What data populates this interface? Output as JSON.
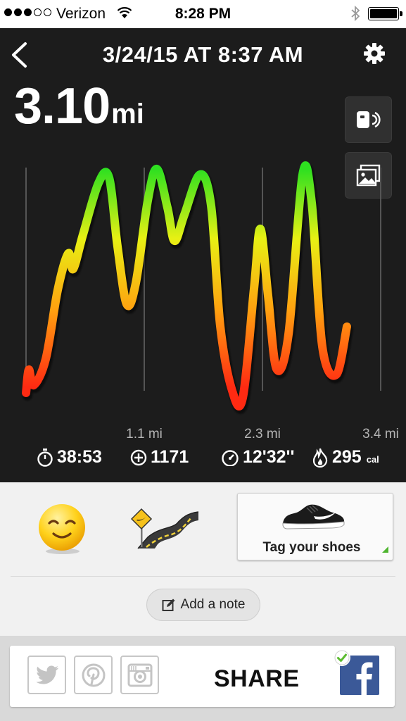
{
  "status_bar": {
    "carrier": "Verizon",
    "time": "8:28 PM"
  },
  "header": {
    "title": "3/24/15 AT 8:37 AM",
    "distance_value": "3.10",
    "distance_unit": "mi"
  },
  "chart_data": {
    "type": "line",
    "x_tick_labels": [
      "1.1 mi",
      "2.3 mi",
      "3.4 mi"
    ],
    "color_scale": [
      "#ff2a12",
      "#ffa010",
      "#e8f014",
      "#2ee020"
    ]
  },
  "stats": {
    "duration": "38:53",
    "elevation": "1171",
    "pace": "12'32''",
    "calories": "295",
    "calories_unit": "cal"
  },
  "shoes": {
    "label": "Tag your shoes"
  },
  "note": {
    "label": "Add a note"
  },
  "share": {
    "label": "SHARE"
  },
  "icons": [
    "back-icon",
    "gear-icon",
    "voice-feedback-icon",
    "photo-icon",
    "stopwatch-icon",
    "elevation-icon",
    "pace-icon",
    "flame-icon",
    "twitter-icon",
    "pinterest-icon",
    "instagram-icon",
    "facebook-icon",
    "checkmark-icon",
    "edit-icon"
  ]
}
